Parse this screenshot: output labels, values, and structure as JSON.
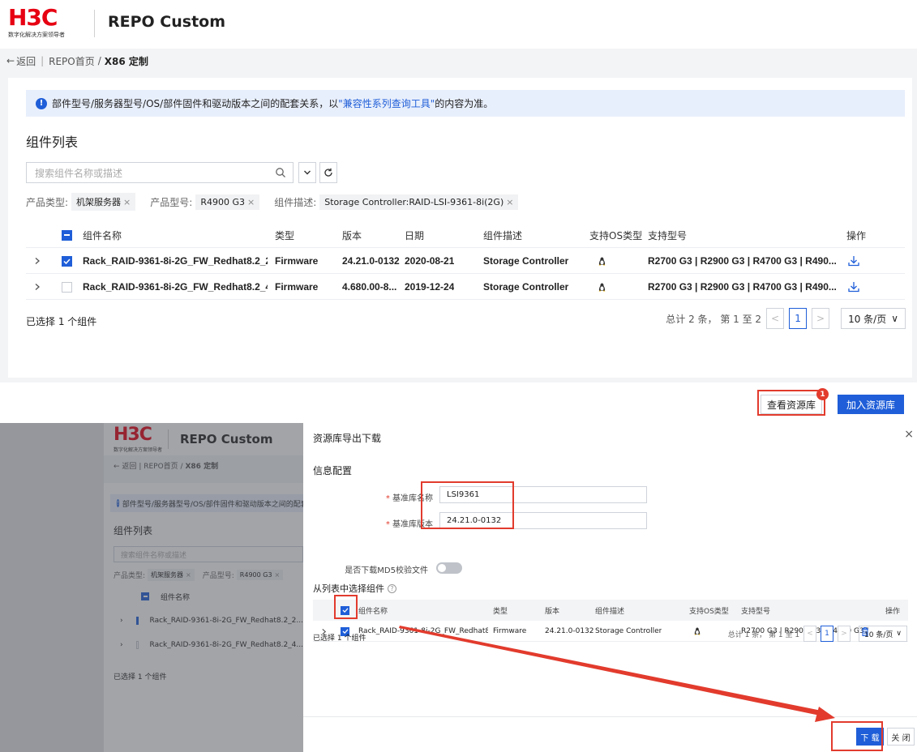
{
  "brand": {
    "logo": "H3C",
    "tagline": "数字化解决方案领导者",
    "app_title": "REPO Custom"
  },
  "breadcrumb": {
    "back": "返回",
    "home": "REPO首页",
    "sep": "/",
    "current": "X86 定制"
  },
  "notice": {
    "before": "部件型号/服务器型号/OS/部件固件和驱动版本之间的配套关系，以",
    "link": "\"兼容性系列查询工具\"",
    "after": "的内容为准。"
  },
  "section_title": "组件列表",
  "search": {
    "placeholder": "搜索组件名称或描述"
  },
  "filters": [
    {
      "label": "产品类型:",
      "value": "机架服务器"
    },
    {
      "label": "产品型号:",
      "value": "R4900 G3"
    },
    {
      "label": "组件描述:",
      "value": "Storage Controller:RAID-LSI-9361-8i(2G)"
    }
  ],
  "table": {
    "headers": {
      "name": "组件名称",
      "type": "类型",
      "version": "版本",
      "date": "日期",
      "desc": "组件描述",
      "os": "支持OS类型",
      "model": "支持型号",
      "action": "操作"
    },
    "rows": [
      {
        "checked": true,
        "name": "Rack_RAID-9361-8i-2G_FW_Redhat8.2_2...",
        "type": "Firmware",
        "version": "24.21.0-0132",
        "date": "2020-08-21",
        "desc": "Storage Controller",
        "models": "R2700 G3 | R2900 G3 | R4700 G3 | R490..."
      },
      {
        "checked": false,
        "name": "Rack_RAID-9361-8i-2G_FW_Redhat8.2_4...",
        "type": "Firmware",
        "version": "4.680.00-8...",
        "date": "2019-12-24",
        "desc": "Storage Controller",
        "models": "R2700 G3 | R2900 G3 | R4700 G3 | R490..."
      }
    ]
  },
  "selected_note": "已选择 1 个组件",
  "pager": {
    "summary": "总计 2 条， 第 1 至 2",
    "page": "1",
    "page_size": "10 条/页"
  },
  "actions": {
    "view_repo": "查看资源库",
    "badge": "1",
    "add_repo": "加入资源库"
  },
  "bg": {
    "filters": [
      {
        "label": "产品类型:",
        "value": "机架服务器"
      },
      {
        "label": "产品型号:",
        "value": "R4900 G3"
      }
    ],
    "rows": [
      "组件名称",
      "Rack_RAID-9361-8i-2G_FW_Redhat8.2_2...",
      "Rack_RAID-9361-8i-2G_FW_Redhat8.2_4..."
    ]
  },
  "modal": {
    "title": "资源库导出下载",
    "close": "×",
    "section": "信息配置",
    "fields": [
      {
        "label": "基准库名称",
        "value": "LSI9361"
      },
      {
        "label": "基准库版本",
        "value": "24.21.0-0132"
      }
    ],
    "md5_label": "是否下载MD5校验文件",
    "list_title": "从列表中选择组件",
    "help": "?",
    "headers": {
      "name": "组件名称",
      "type": "类型",
      "version": "版本",
      "desc": "组件描述",
      "os": "支持OS类型",
      "model": "支持型号",
      "action": "操作"
    },
    "row": {
      "name": "Rack_RAID-9361-8i-2G_FW_Redhat8....",
      "type": "Firmware",
      "version": "24.21.0-0132",
      "desc": "Storage Controller",
      "models": "R2700 G3 | R2900 G3 | R4700 G3 | R4..."
    },
    "selected_note": "已选择 1 个组件",
    "pager": {
      "summary": "总计 1 条， 第 1 至 1",
      "page": "1",
      "page_size": "10 条/页"
    },
    "download": "下 载",
    "close_btn": "关 闭"
  },
  "colors": {
    "brand_red": "#e60012",
    "primary": "#1f5ed8",
    "highlight": "#e23b2d"
  },
  "icons": [
    "search-icon",
    "chevron-down-icon",
    "refresh-icon",
    "expand-icon",
    "check-icon",
    "linux-icon",
    "download-icon",
    "delete-icon",
    "info-icon",
    "close-icon",
    "help-icon"
  ]
}
